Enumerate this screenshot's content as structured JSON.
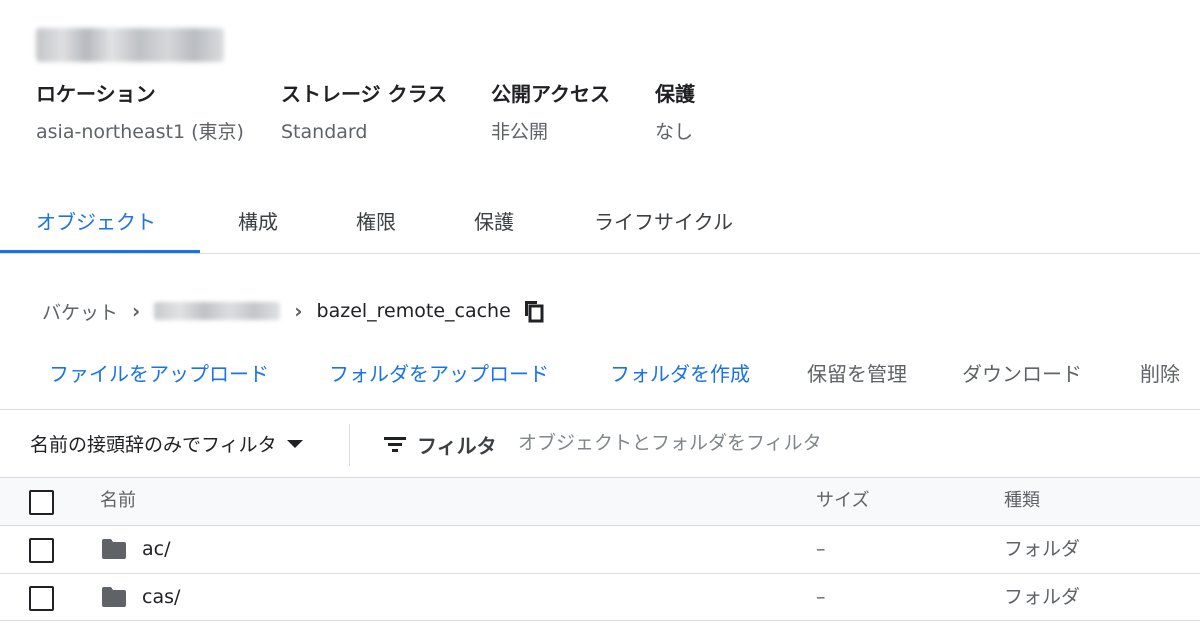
{
  "bucket": {
    "details": [
      {
        "label": "ロケーション",
        "value": "asia-northeast1 (東京)"
      },
      {
        "label": "ストレージ クラス",
        "value": "Standard"
      },
      {
        "label": "公開アクセス",
        "value": "非公開"
      },
      {
        "label": "保護",
        "value": "なし"
      }
    ]
  },
  "tabs": [
    {
      "label": "オブジェクト",
      "active": true
    },
    {
      "label": "構成"
    },
    {
      "label": "権限"
    },
    {
      "label": "保護"
    },
    {
      "label": "ライフサイクル"
    }
  ],
  "breadcrumb": {
    "root": "バケット",
    "current": "bazel_remote_cache"
  },
  "actions": {
    "upload_file": "ファイルをアップロード",
    "upload_folder": "フォルダをアップロード",
    "create_folder": "フォルダを作成",
    "manage_holds": "保留を管理",
    "download": "ダウンロード",
    "delete": "削除"
  },
  "filter": {
    "prefix_label": "名前の接頭辞のみでフィルタ",
    "label": "フィルタ",
    "placeholder": "オブジェクトとフォルダをフィルタ"
  },
  "table": {
    "columns": {
      "name": "名前",
      "size": "サイズ",
      "kind": "種類"
    },
    "rows": [
      {
        "name": "ac/",
        "size": "–",
        "kind": "フォルダ"
      },
      {
        "name": "cas/",
        "size": "–",
        "kind": "フォルダ"
      }
    ]
  },
  "colors": {
    "accent": "#1a73e8",
    "text": "#202124",
    "muted": "#5f6368",
    "divider": "#dadce0"
  },
  "icons": {
    "copy": "copy-icon",
    "folder": "folder-icon",
    "filter": "filter-icon",
    "dropdown": "caret-down-icon"
  }
}
